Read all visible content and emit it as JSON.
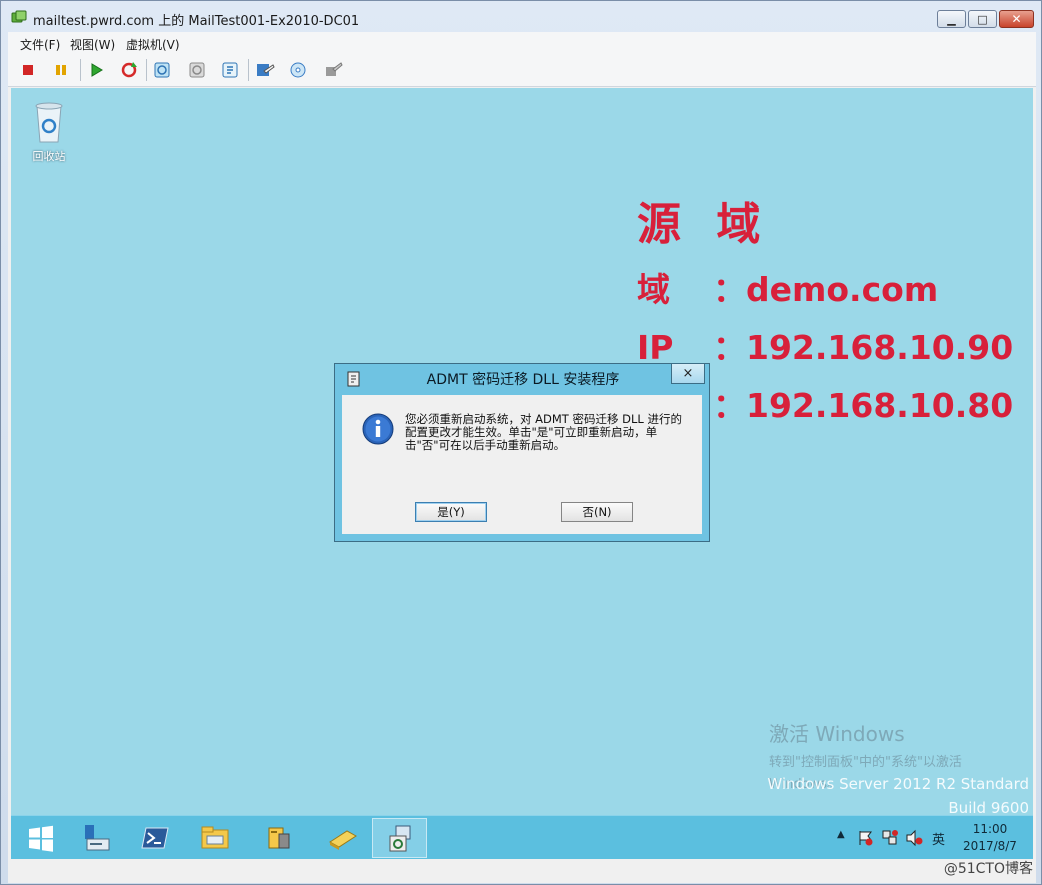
{
  "window": {
    "title": "mailtest.pwrd.com 上的 MailTest001-Ex2010-DC01"
  },
  "menu": {
    "items": [
      "文件(F)",
      "视图(W)",
      "虚拟机(V)"
    ]
  },
  "toolbar": {
    "icons": [
      "stop-icon",
      "pause-icon",
      "start-icon",
      "reset-icon",
      "checkpoint-icon",
      "revert-icon",
      "snapshot-manager-icon",
      "settings-icon",
      "insert-disk-icon",
      "tools-icon"
    ]
  },
  "desktop": {
    "recycle_bin_label": "回收站"
  },
  "overlay": {
    "title": "源 域",
    "lines": [
      {
        "key": "域",
        "value": "：demo.com"
      },
      {
        "key": "IP",
        "value": "：192.168.10.90"
      },
      {
        "key": "",
        "value": "：192.168.10.80"
      }
    ]
  },
  "dialog": {
    "title": "ADMT 密码迁移 DLL 安装程序",
    "close_label": "×",
    "message": "您必须重新启动系统，对 ADMT 密码迁移 DLL 进行的配置更改才能生效。单击\"是\"可立即重新启动，单击\"否\"可在以后手动重新启动。",
    "yes_label": "是(Y)",
    "no_label": "否(N)"
  },
  "watermark": {
    "line1": "激活 Windows",
    "line2": "转到\"控制面板\"中的\"系统\"以激活",
    "line3": "Windows。"
  },
  "os_info": {
    "line1": "Windows Server 2012 R2 Standard",
    "line2": "Build 9600"
  },
  "taskbar": {
    "apps": [
      "start-icon",
      "server-manager-icon",
      "powershell-icon",
      "file-explorer-icon",
      "admt-icon",
      "folder-icon",
      "installer-icon"
    ],
    "tray_arrow": "▲",
    "ime": "英",
    "time": "11:00",
    "date": "2017/8/7"
  },
  "credit": "@51CTO博客",
  "colors": {
    "desktop": "#9bd8e8",
    "overlay_red": "#d8203a",
    "taskbar": "#5bbfdf"
  }
}
